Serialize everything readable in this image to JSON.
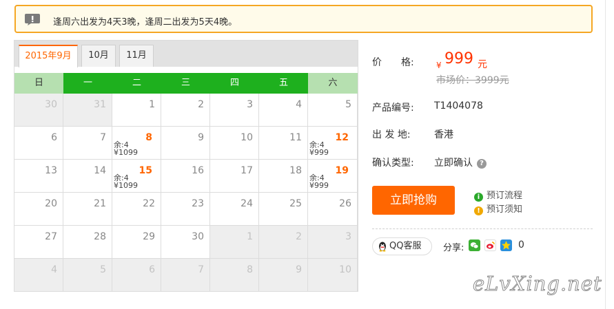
{
  "notice": {
    "text": "逢周六出发为4天3晚，逢周二出发为5天4晚。",
    "icon": "alert-icon"
  },
  "calendar": {
    "tabs": [
      {
        "label": "2015年9月",
        "active": true
      },
      {
        "label": "10月",
        "active": false
      },
      {
        "label": "11月",
        "active": false
      }
    ],
    "weekdays": [
      "日",
      "一",
      "二",
      "三",
      "四",
      "五",
      "六"
    ],
    "weeks": [
      [
        {
          "day": "30",
          "off": true
        },
        {
          "day": "31",
          "off": true
        },
        {
          "day": "1"
        },
        {
          "day": "2"
        },
        {
          "day": "3"
        },
        {
          "day": "4"
        },
        {
          "day": "5"
        }
      ],
      [
        {
          "day": "6"
        },
        {
          "day": "7"
        },
        {
          "day": "8",
          "rest": "余:4",
          "price": "¥1099"
        },
        {
          "day": "9"
        },
        {
          "day": "10"
        },
        {
          "day": "11"
        },
        {
          "day": "12",
          "rest": "余:4",
          "price": "¥999"
        }
      ],
      [
        {
          "day": "13"
        },
        {
          "day": "14"
        },
        {
          "day": "15",
          "rest": "余:4",
          "price": "¥1099"
        },
        {
          "day": "16"
        },
        {
          "day": "17"
        },
        {
          "day": "18"
        },
        {
          "day": "19",
          "rest": "余:4",
          "price": "¥999"
        }
      ],
      [
        {
          "day": "20"
        },
        {
          "day": "21"
        },
        {
          "day": "22"
        },
        {
          "day": "23"
        },
        {
          "day": "24"
        },
        {
          "day": "25"
        },
        {
          "day": "26"
        }
      ],
      [
        {
          "day": "27"
        },
        {
          "day": "28"
        },
        {
          "day": "29"
        },
        {
          "day": "30"
        },
        {
          "day": "1",
          "off": true
        },
        {
          "day": "2",
          "off": true
        },
        {
          "day": "3",
          "off": true
        }
      ],
      [
        {
          "day": "4",
          "off": true
        },
        {
          "day": "5",
          "off": true
        },
        {
          "day": "6",
          "off": true
        },
        {
          "day": "7",
          "off": true
        },
        {
          "day": "8",
          "off": true
        },
        {
          "day": "9",
          "off": true
        },
        {
          "day": "10",
          "off": true
        }
      ]
    ]
  },
  "product": {
    "price_label": "价　　格:",
    "currency": "¥",
    "price": "999",
    "price_unit": "元",
    "market_price": "市场价：3999元",
    "code_label": "产品编号:",
    "code": "T1404078",
    "departure_label": "出 发 地:",
    "departure": "香港",
    "confirm_label": "确认类型:",
    "confirm": "立即确认",
    "buy_button": "立即抢购",
    "booking_flow": "预订流程",
    "booking_notice": "预订须知",
    "qq_service": "QQ客服",
    "share_label": "分享:",
    "share_count": "0"
  },
  "watermark": "eLvXing.net",
  "colors": {
    "accent": "#ff6600",
    "green": "#1eb01e",
    "price": "#ff3300",
    "notice_border": "#f5a623"
  }
}
